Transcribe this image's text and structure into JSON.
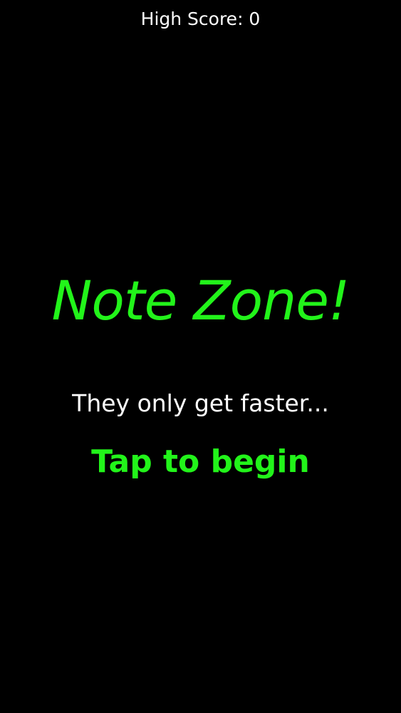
{
  "header": {
    "high_score_text": "High Score: 0"
  },
  "main": {
    "title": "Note Zone!",
    "subtitle": "They only get faster...",
    "start_label": "Tap to begin"
  },
  "colors": {
    "background": "#000000",
    "accent": "#22f41a",
    "text": "#ffffff"
  }
}
